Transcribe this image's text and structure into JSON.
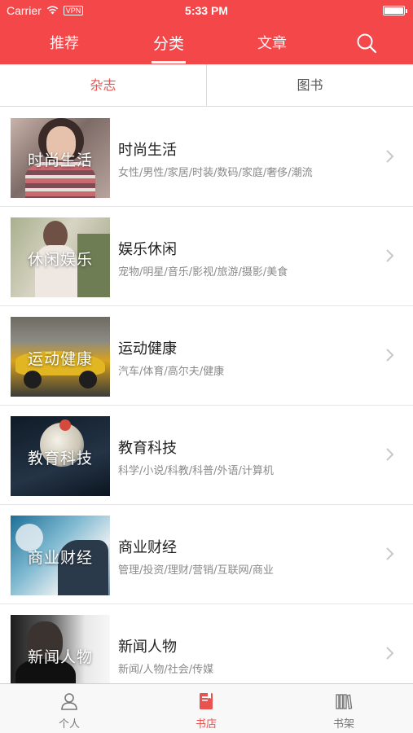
{
  "status_bar": {
    "carrier": "Carrier",
    "vpn": "VPN",
    "time": "5:33 PM",
    "battery_level": 1.0
  },
  "nav": {
    "tabs": [
      {
        "label": "推荐",
        "active": false
      },
      {
        "label": "分类",
        "active": true
      },
      {
        "label": "文章",
        "active": false
      }
    ],
    "search_icon": "search-icon"
  },
  "segment": {
    "options": [
      {
        "label": "杂志",
        "active": true
      },
      {
        "label": "图书",
        "active": false
      }
    ]
  },
  "categories": [
    {
      "thumb_label": "时尚生活",
      "title": "时尚生活",
      "subtitle": "女性/男性/家居/时装/数码/家庭/奢侈/潮流"
    },
    {
      "thumb_label": "休闲娱乐",
      "title": "娱乐休闲",
      "subtitle": "宠物/明星/音乐/影视/旅游/摄影/美食"
    },
    {
      "thumb_label": "运动健康",
      "title": "运动健康",
      "subtitle": "汽车/体育/高尔夫/健康"
    },
    {
      "thumb_label": "教育科技",
      "title": "教育科技",
      "subtitle": "科学/小说/科教/科普/外语/计算机"
    },
    {
      "thumb_label": "商业财经",
      "title": "商业财经",
      "subtitle": "管理/投资/理财/营销/互联网/商业"
    },
    {
      "thumb_label": "新闻人物",
      "title": "新闻人物",
      "subtitle": "新闻/人物/社会/传媒"
    }
  ],
  "tabbar": {
    "items": [
      {
        "label": "个人",
        "icon": "person-icon",
        "active": false
      },
      {
        "label": "书店",
        "icon": "bookstore-icon",
        "active": true
      },
      {
        "label": "书架",
        "icon": "bookshelf-icon",
        "active": false
      }
    ]
  },
  "colors": {
    "accent": "#f4474a",
    "active_text": "#e8534f"
  }
}
